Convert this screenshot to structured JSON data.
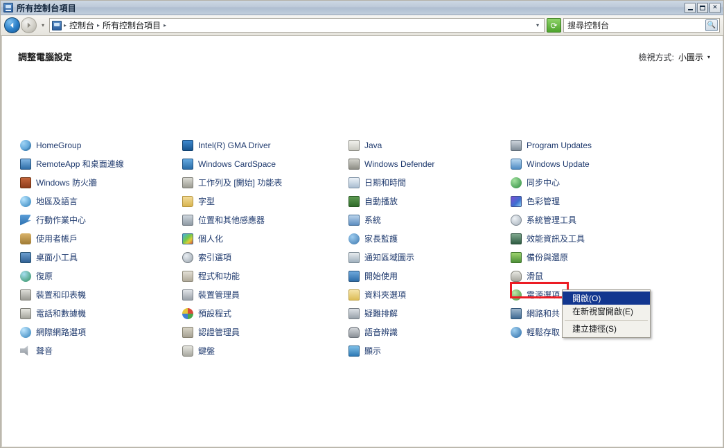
{
  "window": {
    "title": "所有控制台項目",
    "icon": "control-panel-icon",
    "buttons": {
      "minimize": "_",
      "maximize": "▢",
      "close": "✕"
    }
  },
  "toolbar": {
    "back_label": "◀",
    "forward_label": "▶",
    "history_caret": "▾",
    "breadcrumbs": [
      "控制台",
      "所有控制台項目"
    ],
    "crumb_separator": "▸",
    "crumb_end_caret": "▾",
    "refresh_label": "⟳",
    "search": {
      "placeholder": "搜尋控制台",
      "value": "",
      "go_icon": "search-icon",
      "go_label": "🔍"
    }
  },
  "page": {
    "title": "調整電腦設定",
    "view_by_label": "檢視方式:",
    "view_by_value": "小圖示",
    "view_by_caret": "▾"
  },
  "columns": [
    {
      "items": [
        {
          "label": "HomeGroup",
          "icon": "homegroup-icon",
          "css": "ico-homegroup"
        },
        {
          "label": "RemoteApp 和桌面連線",
          "icon": "remoteapp-icon",
          "css": "ico-remoteapp"
        },
        {
          "label": "Windows 防火牆",
          "icon": "firewall-icon",
          "css": "ico-firewall"
        },
        {
          "label": "地區及語言",
          "icon": "region-language-icon",
          "css": "ico-region"
        },
        {
          "label": "行動作業中心",
          "icon": "action-center-flag-icon",
          "css": "ico-flag"
        },
        {
          "label": "使用者帳戶",
          "icon": "user-accounts-icon",
          "css": "ico-users"
        },
        {
          "label": "桌面小工具",
          "icon": "desktop-gadgets-icon",
          "css": "ico-gadgets"
        },
        {
          "label": "復原",
          "icon": "recovery-icon",
          "css": "ico-recovery"
        },
        {
          "label": "裝置和印表機",
          "icon": "devices-printers-icon",
          "css": "ico-printer"
        },
        {
          "label": "電話和數據機",
          "icon": "phone-modem-icon",
          "css": "ico-phone"
        },
        {
          "label": "網際網路選項",
          "icon": "internet-options-icon",
          "css": "ico-internet"
        },
        {
          "label": "聲音",
          "icon": "sound-icon",
          "css": "ico-sound"
        }
      ]
    },
    {
      "items": [
        {
          "label": "Intel(R) GMA Driver",
          "icon": "intel-gma-icon",
          "css": "ico-intel"
        },
        {
          "label": "Windows CardSpace",
          "icon": "cardspace-icon",
          "css": "ico-cardspace"
        },
        {
          "label": "工作列及 [開始] 功能表",
          "icon": "taskbar-startmenu-icon",
          "css": "ico-taskbar"
        },
        {
          "label": "字型",
          "icon": "fonts-icon",
          "css": "ico-fonts"
        },
        {
          "label": "位置和其他感應器",
          "icon": "location-sensors-icon",
          "css": "ico-sensors"
        },
        {
          "label": "個人化",
          "icon": "personalization-icon",
          "css": "ico-personalize"
        },
        {
          "label": "索引選項",
          "icon": "indexing-options-icon",
          "css": "ico-indexing"
        },
        {
          "label": "程式和功能",
          "icon": "programs-features-icon",
          "css": "ico-programs"
        },
        {
          "label": "裝置管理員",
          "icon": "device-manager-icon",
          "css": "ico-devmgr"
        },
        {
          "label": "預設程式",
          "icon": "default-programs-icon",
          "css": "ico-defaultprog"
        },
        {
          "label": "認證管理員",
          "icon": "credential-manager-icon",
          "css": "ico-credential"
        },
        {
          "label": "鍵盤",
          "icon": "keyboard-icon",
          "css": "ico-keyboard"
        }
      ]
    },
    {
      "items": [
        {
          "label": "Java",
          "icon": "java-icon",
          "css": "ico-java"
        },
        {
          "label": "Windows Defender",
          "icon": "windows-defender-icon",
          "css": "ico-defender"
        },
        {
          "label": "日期和時間",
          "icon": "date-time-icon",
          "css": "ico-datetime"
        },
        {
          "label": "自動播放",
          "icon": "autoplay-icon",
          "css": "ico-autoplay"
        },
        {
          "label": "系統",
          "icon": "system-icon",
          "css": "ico-system"
        },
        {
          "label": "家長監護",
          "icon": "parental-controls-icon",
          "css": "ico-parental"
        },
        {
          "label": "通知區域圖示",
          "icon": "notification-area-icon",
          "css": "ico-notifyarea"
        },
        {
          "label": "開始使用",
          "icon": "getting-started-icon",
          "css": "ico-getstart"
        },
        {
          "label": "資料夾選項",
          "icon": "folder-options-icon",
          "css": "ico-folderopt"
        },
        {
          "label": "疑難排解",
          "icon": "troubleshooting-icon",
          "css": "ico-trouble"
        },
        {
          "label": "語音辨識",
          "icon": "speech-recognition-icon",
          "css": "ico-speech"
        },
        {
          "label": "顯示",
          "icon": "display-icon",
          "css": "ico-display"
        }
      ]
    },
    {
      "items": [
        {
          "label": "Program Updates",
          "icon": "program-updates-icon",
          "css": "ico-progupd"
        },
        {
          "label": "Windows Update",
          "icon": "windows-update-icon",
          "css": "ico-winupd"
        },
        {
          "label": "同步中心",
          "icon": "sync-center-icon",
          "css": "ico-sync"
        },
        {
          "label": "色彩管理",
          "icon": "color-management-icon",
          "css": "ico-color"
        },
        {
          "label": "系統管理工具",
          "icon": "administrative-tools-icon",
          "css": "ico-admin"
        },
        {
          "label": "效能資訊及工具",
          "icon": "performance-info-icon",
          "css": "ico-perf"
        },
        {
          "label": "備份與還原",
          "icon": "backup-restore-icon",
          "css": "ico-backup"
        },
        {
          "label": "滑鼠",
          "icon": "mouse-icon",
          "css": "ico-mouse"
        },
        {
          "label": "電源選項",
          "icon": "power-options-icon",
          "css": "ico-power"
        },
        {
          "label": "網路和共",
          "icon": "network-sharing-icon",
          "css": "ico-network"
        },
        {
          "label": "輕鬆存取",
          "icon": "ease-of-access-icon",
          "css": "ico-ease"
        }
      ]
    }
  ],
  "highlight": {
    "target_label": "電源選項",
    "color": "#ec1c24"
  },
  "context_menu": {
    "items": [
      {
        "label": "開啟(O)",
        "selected": true,
        "separator_after": false
      },
      {
        "label": "在新視窗開啟(E)",
        "selected": false,
        "separator_after": true
      },
      {
        "label": "建立捷徑(S)",
        "selected": false,
        "separator_after": false
      }
    ],
    "selected_color": "#12368f"
  }
}
